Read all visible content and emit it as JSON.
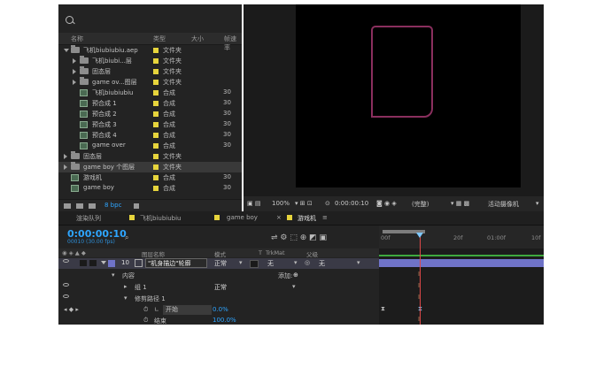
{
  "project": {
    "search_icon": "search-icon",
    "columns": [
      "名称",
      "类型",
      "大小",
      "帧速率"
    ],
    "items": [
      {
        "indent": 0,
        "kind": "folder",
        "expand": "open",
        "name": "飞机biubiubiu.aep",
        "type": "文件夹",
        "size": ""
      },
      {
        "indent": 1,
        "kind": "folder",
        "expand": "closed",
        "name": "飞机biubi...层",
        "type": "文件夹",
        "size": ""
      },
      {
        "indent": 1,
        "kind": "folder",
        "expand": "closed",
        "name": "固态层",
        "type": "文件夹",
        "size": ""
      },
      {
        "indent": 1,
        "kind": "folder",
        "expand": "closed",
        "name": "game ov...图层",
        "type": "文件夹",
        "size": ""
      },
      {
        "indent": 1,
        "kind": "comp",
        "expand": "",
        "name": "飞机biubiubiu",
        "type": "合成",
        "size": "30"
      },
      {
        "indent": 1,
        "kind": "comp",
        "expand": "",
        "name": "预合成 1",
        "type": "合成",
        "size": "30"
      },
      {
        "indent": 1,
        "kind": "comp",
        "expand": "",
        "name": "预合成 2",
        "type": "合成",
        "size": "30"
      },
      {
        "indent": 1,
        "kind": "comp",
        "expand": "",
        "name": "预合成 3",
        "type": "合成",
        "size": "30"
      },
      {
        "indent": 1,
        "kind": "comp",
        "expand": "",
        "name": "预合成 4",
        "type": "合成",
        "size": "30"
      },
      {
        "indent": 1,
        "kind": "comp",
        "expand": "",
        "name": "game over",
        "type": "合成",
        "size": "30"
      },
      {
        "indent": 0,
        "kind": "folder",
        "expand": "closed",
        "name": "固态层",
        "type": "文件夹",
        "size": ""
      },
      {
        "indent": 0,
        "kind": "folder",
        "expand": "closed",
        "name": "game boy 个图层",
        "type": "文件夹",
        "size": "",
        "selected": true
      },
      {
        "indent": 0,
        "kind": "comp",
        "expand": "",
        "name": "游戏机",
        "type": "合成",
        "size": "30"
      },
      {
        "indent": 0,
        "kind": "comp",
        "expand": "",
        "name": "game boy",
        "type": "合成",
        "size": "30"
      }
    ],
    "footer_bpc": "8 bpc"
  },
  "viewer": {
    "zoom": "100%",
    "timecode": "0:00:00:10",
    "resolution": "(完整)",
    "camera": "活动摄像机",
    "colors": {
      "shape_stroke": "#8a2f5e",
      "canvas": "#000000"
    }
  },
  "timeline": {
    "tabs": [
      "渲染队列",
      "飞机biubiubiu",
      "game boy",
      "游戏机"
    ],
    "active_tab": "游戏机",
    "timecode": "0:00:00:10",
    "fps": "00010 (30.00 fps)",
    "columns": [
      "图层名称",
      "模式",
      "T",
      "TrkMat",
      "父级"
    ],
    "layer": {
      "number": "10",
      "name": "\"机身描边\"轮廓",
      "mode": "正常",
      "trkmat": "无",
      "parent": "无"
    },
    "rows": [
      {
        "label": "内容",
        "extra": "添加:"
      },
      {
        "label": "组 1",
        "mode": "正常"
      },
      {
        "label": "修剪路径 1"
      },
      {
        "label": "开始",
        "value": "0.0%"
      },
      {
        "label": "结束",
        "value": "100.0%"
      }
    ],
    "ruler": [
      "00f",
      "20f",
      "01:00f",
      "10f"
    ],
    "colors": {
      "timecode": "#2ea5ff",
      "layer_bar": "#6f73c8",
      "cti": "#e04848"
    }
  }
}
